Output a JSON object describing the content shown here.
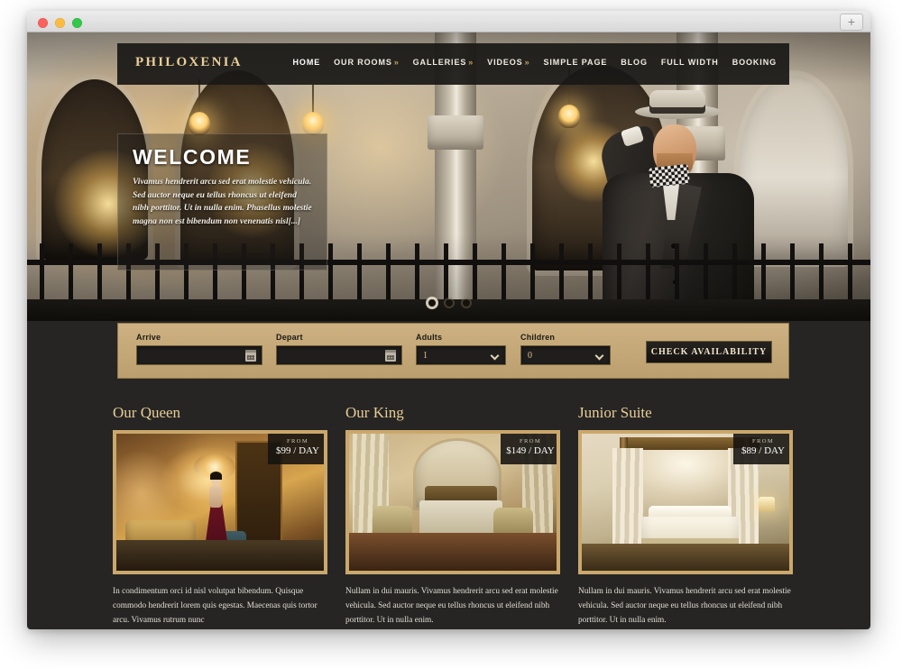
{
  "browser": {
    "traffic_lights": [
      "close",
      "minimize",
      "maximize"
    ],
    "new_tab_label": "+"
  },
  "header": {
    "brand": "PHILOXENIA",
    "nav": [
      {
        "label": "HOME",
        "caret": "",
        "active": true
      },
      {
        "label": "OUR ROOMS",
        "caret": "»",
        "active": false
      },
      {
        "label": "GALLERIES",
        "caret": "»",
        "active": false
      },
      {
        "label": "VIDEOS",
        "caret": "»",
        "active": false
      },
      {
        "label": "SIMPLE PAGE",
        "caret": "",
        "active": false
      },
      {
        "label": "BLOG",
        "caret": "",
        "active": false
      },
      {
        "label": "FULL WIDTH",
        "caret": "",
        "active": false
      },
      {
        "label": "BOOKING",
        "caret": "",
        "active": false
      }
    ]
  },
  "hero": {
    "welcome_title": "WELCOME",
    "welcome_body": "Vivamus hendrerit arcu sed erat molestie vehicula. Sed auctor neque eu tellus rhoncus ut eleifend nibh porttitor. Ut in nulla enim. Phasellus molestie magna non est bibendum non venenatis nisl[...]",
    "slides": 3,
    "active_slide": 1
  },
  "booking": {
    "arrive_label": "Arrive",
    "arrive_value": "",
    "depart_label": "Depart",
    "depart_value": "",
    "adults_label": "Adults",
    "adults_value": "1",
    "children_label": "Children",
    "children_value": "0",
    "submit_label": "CHECK AVAILABILITY",
    "bar_color": "#c4a876"
  },
  "rooms": [
    {
      "title": "Our Queen",
      "price_from_label": "FROM",
      "price": "$99 / DAY",
      "description": "In condimentum orci id nisl volutpat bibendum. Quisque commodo hendrerit lorem quis egestas. Maecenas quis tortor arcu. Vivamus rutrum nunc"
    },
    {
      "title": "Our King",
      "price_from_label": "FROM",
      "price": "$149 / DAY",
      "description": "Nullam in dui mauris. Vivamus hendrerit arcu sed erat molestie vehicula. Sed auctor neque eu tellus rhoncus ut eleifend nibh porttitor. Ut in nulla enim."
    },
    {
      "title": "Junior Suite",
      "price_from_label": "FROM",
      "price": "$89 / DAY",
      "description": "Nullam in dui mauris. Vivamus hendrerit arcu sed erat molestie vehicula. Sed auctor neque eu tellus rhoncus ut eleifend nibh porttitor. Ut in nulla enim."
    }
  ],
  "theme": {
    "gold": "#e8cd95",
    "dark_bg": "#262524",
    "nav_bg": "#1a1917",
    "frame_gold": "#caa86c"
  }
}
